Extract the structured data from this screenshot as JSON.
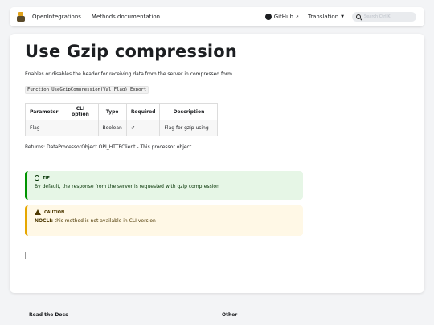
{
  "navbar": {
    "brand": "OpenIntegrations",
    "docs_link": "Methods documentation",
    "github": "GitHub",
    "translation": "Translation",
    "search_placeholder": "Search Ctrl K"
  },
  "page": {
    "title": "Use Gzip compression",
    "description": "Enables or disables the header for receiving data from the server in compressed form",
    "signature": "Function UseGzipCompression(Val Flag) Export",
    "table": {
      "headers": [
        "Parameter",
        "CLI option",
        "Type",
        "Required",
        "Description"
      ],
      "rows": [
        [
          "Flag",
          "-",
          "Boolean",
          "✔",
          "Flag for gzip using"
        ]
      ]
    },
    "returns": "Returns: DataProcessorObject.OPI_HTTPClient - This processor object",
    "tip": {
      "label": "TIP",
      "text": "By default, the response from the server is requested with gzip compression"
    },
    "caution": {
      "label": "CAUTION",
      "bold": "NOCLI:",
      "text": " this method is not available in CLI version"
    }
  },
  "footer": {
    "col1": "Read the Docs",
    "col2": "Other"
  },
  "colors": {
    "tip_border": "#009400",
    "caution_border": "#e6a700"
  }
}
